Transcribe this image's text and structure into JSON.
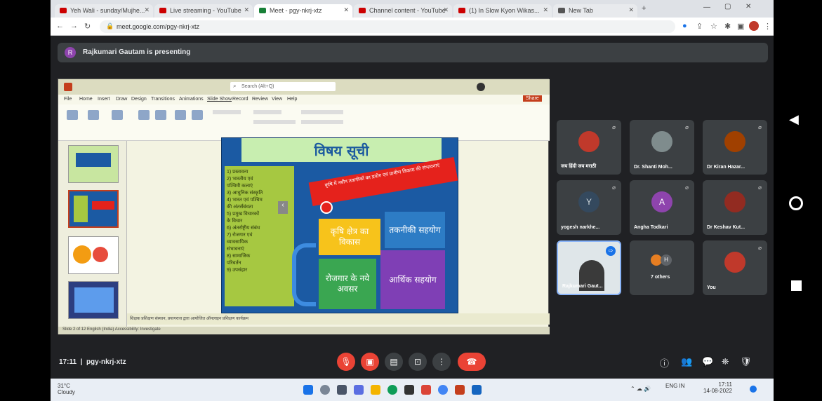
{
  "browser": {
    "tabs": [
      {
        "label": "Yeh Wali - sunday/Mujhe...",
        "active": false
      },
      {
        "label": "Live streaming - YouTube",
        "active": false
      },
      {
        "label": "Meet - pgy-nkrj-xtz",
        "active": true
      },
      {
        "label": "Channel content - YouTube",
        "active": false
      },
      {
        "label": "(1) In Slow Kyon Wikas...",
        "active": false
      },
      {
        "label": "New Tab",
        "active": false
      }
    ],
    "url": "meet.google.com/pgy-nkrj-xtz"
  },
  "presenting": {
    "initial": "R",
    "text": "Rajkumari Gautam is presenting"
  },
  "ppt": {
    "search": "Search (Alt+Q)",
    "menu": [
      "File",
      "Home",
      "Insert",
      "Draw",
      "Design",
      "Transitions",
      "Animations",
      "Slide Show",
      "Record",
      "Review",
      "View",
      "Help"
    ],
    "share_label": "Share",
    "slide": {
      "title": "विषय सूची",
      "list": "1) प्रस्तावना\n2) भारतीय एवं\nपश्चिमी कलाएं\n3) आधुनिक संस्कृति\n4) भारत एवं पश्चिम\nकी अंतर्संबंधता\n5) प्रमुख विचारकों\nके विचार\n6) अंतर्राष्ट्रीय संबंध\n7) रोजगार एवं\nव्यावसायिक\nसंभावनाएं\n8) सामाजिक\nपरिवर्तन\n9) उपसंहार",
      "banner": "कृषि में नवीन तकनीकों का प्रयोग एवं ग्रामीण विकास की संभावनाएं",
      "box1": "कृषि क्षेत्र का विकास",
      "box2": "तकनीकी सहयोग",
      "box3": "रोजगार के नये अवसर",
      "box4": "आर्थिक सहयोग"
    },
    "footer": "शिक्षक प्रशिक्षण संस्थान, प्रयागराज द्वारा आयोजित ऑनलाइन प्रशिक्षण कार्यक्रम",
    "status": "Slide 2 of 12   English (India)   Accessibility: Investigate"
  },
  "participants": [
    {
      "name": "जय हिंदी जय मराठी",
      "avatar": "photo",
      "color": "#c0392b"
    },
    {
      "name": "Dr. Shanti Moh...",
      "avatar": "photo",
      "color": "#7f8c8d"
    },
    {
      "name": "Dr Kiran Hazar...",
      "avatar": "photo",
      "color": "#a04000"
    },
    {
      "name": "yogesh narkhe...",
      "avatar": "Y",
      "color": "#34495e"
    },
    {
      "name": "Angha Todkari",
      "avatar": "A",
      "color": "#8e44ad"
    },
    {
      "name": "Dr Keshav Kut...",
      "avatar": "photo",
      "color": "#922b21"
    },
    {
      "name": "Rajkumari Gaut...",
      "avatar": "video",
      "color": "#dfe6e9"
    },
    {
      "name": "7 others",
      "avatar": "group",
      "color": "#e67e22"
    },
    {
      "name": "You",
      "avatar": "photo",
      "color": "#c0392b"
    }
  ],
  "bottom": {
    "time": "17:11",
    "code": "pgy-nkrj-xtz"
  },
  "taskbar": {
    "weather_temp": "31°C",
    "weather_text": "Cloudy",
    "clock_time": "17:11",
    "clock_date": "14-08-2022",
    "lang": "ENG IN"
  },
  "colors": {
    "meet_bg": "#202124",
    "end_call": "#ea4335",
    "tile_bg": "#3c4043"
  }
}
